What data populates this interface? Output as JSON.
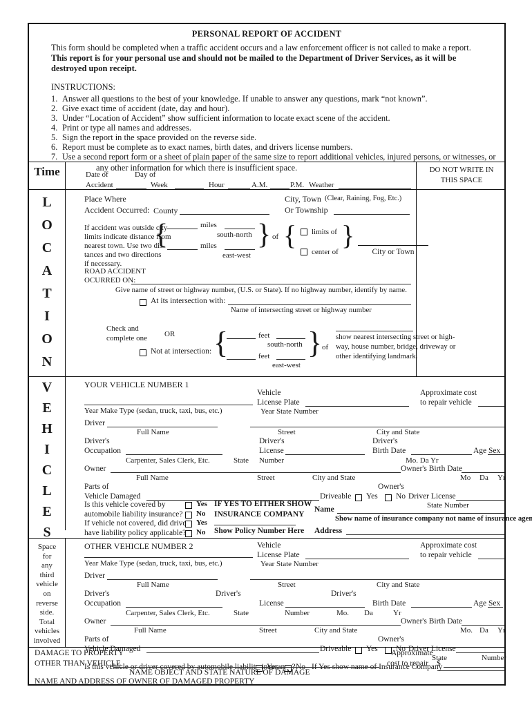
{
  "header": {
    "title": "PERSONAL REPORT OF ACCIDENT",
    "intro_plain": "This form should be completed when a traffic accident occurs and a law enforcement officer is not called to make a report.",
    "intro_bold": "This report is for your personal use and should not be mailed to the Department of Driver Services, as it will be destroyed upon receipt.",
    "instructions_label": "INSTRUCTIONS:",
    "instructions": [
      "Answer all questions to the best of your knowledge.  If unable to answer any questions, mark “not known”.",
      "Give exact time of accident (date, day and hour).",
      "Under “Location of Accident” show sufficient information to locate exact scene of the accident.",
      "Print or type all names and addresses.",
      "Sign the report in the space provided on the reverse side.",
      "Report must be complete as to exact names, birth dates, and drivers license numbers.",
      "Use a second report form or a sheet of plain paper of the same size to report additional vehicles,  injured persons, or witnesses, or"
    ],
    "instructions_continuation": "any other information for which there is insufficient space."
  },
  "do_not_write": {
    "line1": "DO NOT WRITE IN",
    "line2": "THIS SPACE"
  },
  "time_section": {
    "rail_label": "Time",
    "date_of": "Date of",
    "day_of": "Day of",
    "accident": "Accident",
    "week": "Week",
    "hour": "Hour",
    "am": "A.M.",
    "pm": "P.M.",
    "weather": "Weather",
    "weather_hint": "(Clear, Raining, Fog, Etc.)"
  },
  "location_section": {
    "rail_letters": [
      "L",
      "O",
      "C",
      "A",
      "T",
      "I",
      "O",
      "N"
    ],
    "place_where": "Place Where",
    "accident_occurred": "Accident Occurred:",
    "county": "County",
    "city_town": "City, Town",
    "or_township": "Or Township",
    "outside_city_text": [
      "If accident was outside city",
      "limits indicate distance from",
      "nearest town.  Use two dis-",
      "tances and two directions",
      "if necessary."
    ],
    "miles": "miles",
    "south_north": "south-north",
    "east_west": "east-west",
    "of": "of",
    "limits_of": "limits of",
    "center_of": "center of",
    "city_or_town": "City or Town",
    "road_accident": "ROAD ACCIDENT",
    "occurred_on": "OCURRED ON:",
    "give_name_hint": "Give name of street or highway number, (U.S. or State).  If no highway number, identify by name.",
    "at_intersection": "At its intersection with:",
    "name_intersecting": "Name of intersecting street or highway number",
    "check_and": "Check and",
    "complete_one": "complete one",
    "or": "OR",
    "not_at_intersection": "Not at intersection:",
    "feet": "feet",
    "landmark_hint": [
      "show nearest intersecting street or high-",
      "way, house number, bridge, driveway or",
      "other identifying landmark."
    ]
  },
  "vehicles_section": {
    "rail_letters": [
      "V",
      "E",
      "H",
      "I",
      "C",
      "L",
      "E",
      "S"
    ],
    "vehicle1": {
      "title": "YOUR VEHICLE NUMBER 1",
      "year_make_type": "Year    Make   Type (sedan, truck, taxi, bus, etc.)",
      "vehicle": "Vehicle",
      "license_plate": "License Plate",
      "plate_sub": "Year           State        Number",
      "approx_cost": "Approximate cost",
      "to_repair": "to repair vehicle",
      "driver": "Driver",
      "full_name": "Full Name",
      "street": "Street",
      "city_state": "City and State",
      "drivers": "Driver's",
      "occupation": "Occupation",
      "occupation_hint": "Carpenter, Sales Clerk, Etc.",
      "state": "State",
      "license": "License",
      "number": "Number",
      "birth_date": "Birth Date",
      "mo_da_yr": "Mo.        Da        Yr",
      "age": "Age",
      "sex": "Sex",
      "owner": "Owner",
      "owners": "Owner's",
      "owners_birth_date": "Owner's  Birth  Date",
      "mo": "Mo",
      "da": "Da",
      "yr": "Yr",
      "parts_of": "Parts of",
      "vehicle_damaged": "Vehicle Damaged",
      "driveable": "Driveable",
      "yes": "Yes",
      "no": "No",
      "driver_license": "Driver License",
      "state_number": "State Number",
      "q1_line1": "Is this vehicle covered by",
      "q1_line2": "automobile liability insurance?",
      "q2_line1": "If vehicle not covered, did driver",
      "q2_line2": "have liability policy applicable?",
      "opt_yes": "Yes",
      "opt_no": "No",
      "if_yes_line1": "IF YES TO EITHER SHOW",
      "if_yes_line2": "INSURANCE COMPANY",
      "show_policy": "Show Policy Number Here",
      "name": "Name",
      "insurance_note": "Show name of insurance company not name of insurance agency.",
      "address": "Address"
    },
    "vehicle2": {
      "title": "OTHER VEHICLE NUMBER 2",
      "year_make_type": "Year    Make   Type (sedan, truck, taxi, bus, etc.)",
      "vehicle": "Vehicle",
      "license_plate": "License Plate",
      "plate_sub": "Year           State        Number",
      "approx_cost": "Approximate cost",
      "to_repair": "to repair vehicle",
      "driver": "Driver",
      "full_name": "Full Name",
      "street": "Street",
      "city_state": "City and State",
      "drivers": "Driver's",
      "occupation": "Occupation",
      "occupation_hint": "Carpenter, Sales Clerk, Etc.",
      "state": "State",
      "license": "License",
      "number": "Number",
      "mo": "Mo.",
      "da": "Da",
      "yr": "Yr",
      "birth_date": "Birth Date",
      "age": "Age",
      "sex": "Sex",
      "owner": "Owner",
      "owners": "Owner's",
      "owners_birth_date": "Owner's  Birth  Date",
      "parts_of": "Parts of",
      "vehicle_damaged": "Vehicle Damaged",
      "driveable": "Driveable",
      "yes": "Yes",
      "no": "No",
      "driver_license": "Driver License",
      "state_lbl": "State",
      "number_lbl": "Number",
      "insurance_question": "Is this vehicle or driver covered by automobile liability insurance?",
      "if_yes_show": "If Yes show name of Insurance Company"
    },
    "third_vehicle_note": [
      "Space",
      "for",
      "any",
      "third",
      "vehicle",
      "on",
      "reverse",
      "side.",
      "Total",
      "vehicles",
      "involved"
    ]
  },
  "damage_section": {
    "line1": "DAMAGE TO PROPERTY",
    "line2": "OTHER THAN VEHICLE",
    "hint": "NAME OBJECT AND STATE NATURE OF DAMAGE",
    "approximate": "Approximate",
    "cost_to_repair": "cost to repair",
    "dollar": "$",
    "owner_line": "NAME AND ADDRESS OF OWNER OF DAMAGED PROPERTY"
  }
}
